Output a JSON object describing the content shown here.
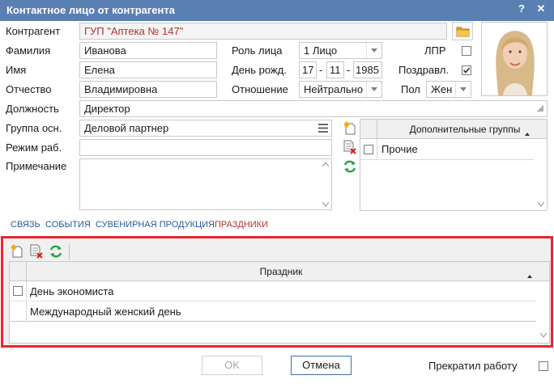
{
  "window": {
    "title": "Контактное лицо от контрагента",
    "help": "?",
    "close": "✕"
  },
  "form": {
    "counterparty": {
      "label": "Контрагент",
      "value": "ГУП \"Аптека № 147\""
    },
    "last_name": {
      "label": "Фамилия",
      "value": "Иванова"
    },
    "first_name": {
      "label": "Имя",
      "value": "Елена"
    },
    "patronymic": {
      "label": "Отчество",
      "value": "Владимировна"
    },
    "role": {
      "label": "Роль лица",
      "value": "1 Лицо"
    },
    "birthday": {
      "label": "День рожд.",
      "day": "17",
      "month": "11",
      "year": "1985",
      "sep": "-"
    },
    "relation": {
      "label": "Отношение",
      "value": "Нейтрально"
    },
    "decision_maker": {
      "label": "ЛПР",
      "checked": false
    },
    "congratulate": {
      "label": "Поздравл.",
      "checked": true
    },
    "gender": {
      "label": "Пол",
      "value": "Жен"
    },
    "position": {
      "label": "Должность",
      "value": "Директор"
    },
    "main_group": {
      "label": "Группа осн.",
      "value": "Деловой партнер"
    },
    "work_mode": {
      "label": "Режим раб.",
      "value": ""
    },
    "note": {
      "label": "Примечание",
      "value": ""
    }
  },
  "additional_groups": {
    "header": "Дополнительные группы",
    "rows": [
      "Прочие"
    ]
  },
  "tabs": [
    {
      "label": "СВЯЗЬ",
      "active": false
    },
    {
      "label": "СОБЫТИЯ",
      "active": false
    },
    {
      "label": "СУВЕНИРНАЯ ПРОДУКЦИЯ",
      "active": false
    },
    {
      "label": "ПРАЗДНИКИ",
      "active": true
    }
  ],
  "holidays": {
    "header": "Праздник",
    "rows": [
      "День экономиста",
      "Международный женский день"
    ]
  },
  "footer": {
    "ok": "OK",
    "cancel": "Отмена",
    "stopped_work": {
      "label": "Прекратил работу",
      "checked": false
    }
  },
  "colors": {
    "titlebar": "#5a7fb3",
    "highlight_border": "#e8262d",
    "active_tab": "#b2332c",
    "tab": "#2a5a96",
    "counterparty_text": "#b2332c"
  }
}
